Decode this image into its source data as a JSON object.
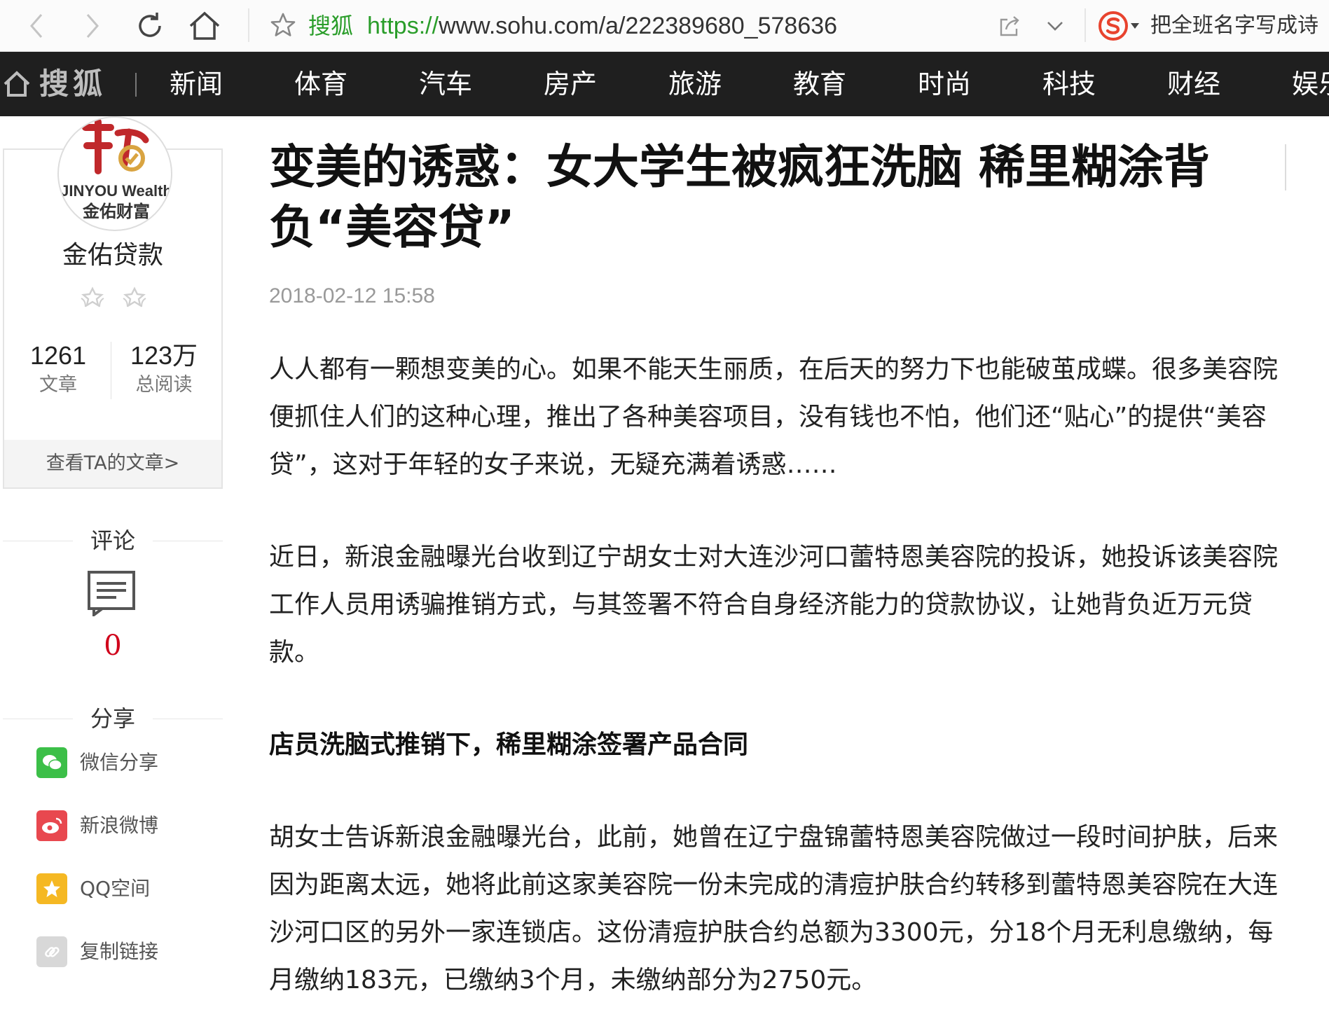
{
  "browser": {
    "site_name": "搜狐",
    "url_protocol": "https://",
    "url_rest": "www.sohu.com/a/222389680_578636",
    "search_hint": "把全班名字写成诗"
  },
  "nav": {
    "logo": "搜狐",
    "items": [
      "新闻",
      "体育",
      "汽车",
      "房产",
      "旅游",
      "教育",
      "时尚",
      "科技",
      "财经",
      "娱乐"
    ]
  },
  "author": {
    "avatar_text_en": "JINYOU Wealth",
    "avatar_text_cn": "金佑财富",
    "name": "金佑贷款",
    "articles_count": "1261",
    "articles_label": "文章",
    "reads_count": "123万",
    "reads_label": "总阅读",
    "view_posts": "查看TA的文章>"
  },
  "comments": {
    "label": "评论",
    "count": "0"
  },
  "share": {
    "label": "分享",
    "items": [
      "微信分享",
      "新浪微博",
      "QQ空间",
      "复制链接"
    ],
    "colors": [
      "#3cbf48",
      "#e8484f",
      "#f5b823",
      "#d8d8d8"
    ]
  },
  "article": {
    "title": "变美的诱惑：女大学生被疯狂洗脑 稀里糊涂背负“美容贷”",
    "time": "2018-02-12 15:58",
    "paragraphs": [
      "人人都有一颗想变美的心。如果不能天生丽质，在后天的努力下也能破茧成蝶。很多美容院便抓住人们的这种心理，推出了各种美容项目，没有钱也不怕，他们还“贴心”的提供“美容贷”，这对于年轻的女子来说，无疑充满着诱惑……",
      "近日，新浪金融曝光台收到辽宁胡女士对大连沙河口蕾特恩美容院的投诉，她投诉该美容院工作人员用诱骗推销方式，与其签署不符合自身经济能力的贷款协议，让她背负近万元贷款。",
      "胡女士告诉新浪金融曝光台，此前，她曾在辽宁盘锦蕾特恩美容院做过一段时间护肤，后来因为距离太远，她将此前这家美容院一份未完成的清痘护肤合约转移到蕾特恩美容院在大连沙河口区的另外一家连锁店。这份清痘护肤合约总额为3300元，分18个月无利息缴纳，每月缴纳183元，已缴纳3个月，未缴纳部分为2750元。"
    ],
    "subhead": "店员洗脑式推销下，稀里糊涂签署产品合同"
  }
}
